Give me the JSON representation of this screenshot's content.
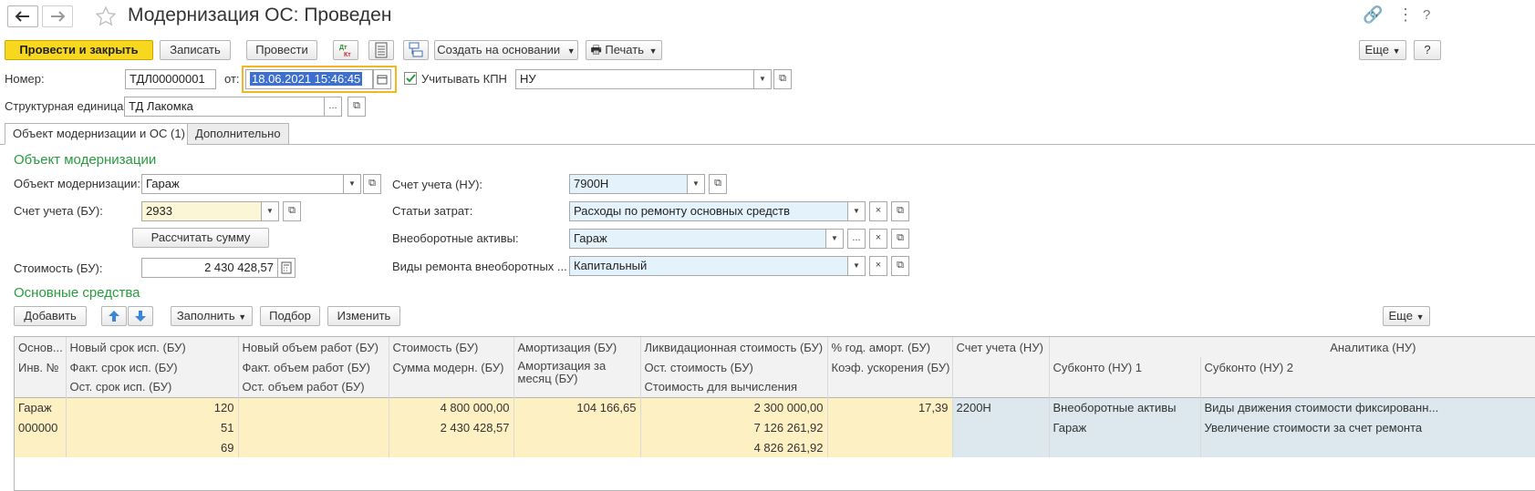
{
  "window": {
    "title": "Модернизация ОС: Проведен"
  },
  "toolbar": {
    "post_close": "Провести и закрыть",
    "save": "Записать",
    "post": "Провести",
    "dt_kt_top": "Дт",
    "dt_kt_bottom": "Кт",
    "create_based": "Создать на основании",
    "print": "Печать",
    "more": "Еще"
  },
  "header": {
    "number_label": "Номер:",
    "number_value": "ТДЛ00000001",
    "from_label": "от:",
    "date_value": "18.06.2021 15:46:45",
    "kpn_label": "Учитывать КПН",
    "kpn_checked": true,
    "kpn_value": "НУ",
    "unit_label": "Структурная единица:",
    "unit_value": "ТД Лакомка"
  },
  "tabs": [
    {
      "label": "Объект модернизации и ОС (1)",
      "active": true
    },
    {
      "label": "Дополнительно",
      "active": false
    }
  ],
  "object_section": {
    "title": "Объект модернизации",
    "object_label": "Объект модернизации:",
    "object_value": "Гараж",
    "account_bu_label": "Счет учета (БУ):",
    "account_bu_value": "2933",
    "calc_button": "Рассчитать сумму",
    "cost_bu_label": "Стоимость (БУ):",
    "cost_bu_value": "2 430 428,57",
    "account_nu_label": "Счет учета (НУ):",
    "account_nu_value": "7900Н",
    "cost_items_label": "Статьи затрат:",
    "cost_items_value": "Расходы по ремонту основных средств",
    "noncurrent_label": "Внеоборотные активы:",
    "noncurrent_value": "Гараж",
    "repair_types_label": "Виды ремонта внеоборотных ...",
    "repair_types_value": "Капитальный"
  },
  "assets_section": {
    "title": "Основные средства",
    "add": "Добавить",
    "fill": "Заполнить",
    "select": "Подбор",
    "change": "Изменить",
    "more": "Еще"
  },
  "table": {
    "header_row1": [
      "Основ...",
      "Новый срок исп. (БУ)",
      "Новый объем работ (БУ)",
      "Стоимость (БУ)",
      "Амортизация (БУ)",
      "Ликвидационная стоимость (БУ)",
      "% год. аморт. (БУ)",
      "Счет учета (НУ)",
      "Аналитика (НУ)"
    ],
    "header_row2": [
      "Инв. №",
      "Факт. срок исп. (БУ)",
      "Факт. объем работ (БУ)",
      "Сумма модерн. (БУ)",
      "Амортизация за месяц (БУ)",
      "Ост. стоимость (БУ)",
      "Коэф. ускорения (БУ)",
      "",
      "Субконто (НУ) 1",
      "Субконто (НУ) 2"
    ],
    "header_row3": [
      "",
      "Ост. срок исп. (БУ)",
      "Ост. объем работ (БУ)",
      "",
      "",
      "Стоимость для вычисления",
      "",
      "",
      "",
      ""
    ],
    "row1": [
      "Гараж",
      "120",
      "",
      "4 800 000,00",
      "104 166,65",
      "2 300 000,00",
      "17,39",
      "2200Н",
      "Внеоборотные активы",
      "Виды движения стоимости фиксированн..."
    ],
    "row2": [
      "000000",
      "51",
      "",
      "2 430 428,57",
      "",
      "7 126 261,92",
      "",
      "",
      "Гараж",
      "Увеличение стоимости за счет ремонта"
    ],
    "row3": [
      "",
      "69",
      "",
      "",
      "",
      "4 826 261,92",
      "",
      "",
      "",
      ""
    ]
  }
}
